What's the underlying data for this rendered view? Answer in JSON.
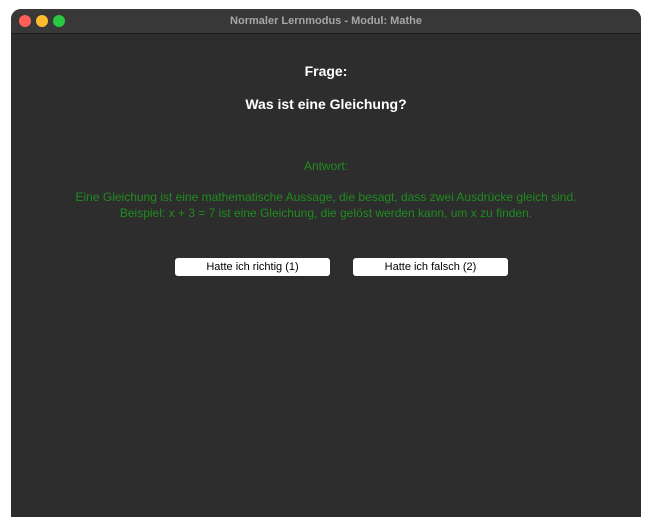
{
  "window": {
    "title": "Normaler Lernmodus - Modul: Mathe"
  },
  "question": {
    "label": "Frage:",
    "text": "Was ist eine Gleichung?"
  },
  "answer": {
    "label": "Antwort:",
    "line1": "Eine Gleichung ist eine mathematische Aussage, die besagt, dass zwei Ausdrücke gleich sind.",
    "line2": "Beispiel: x + 3 = 7 ist eine Gleichung, die gelöst werden kann, um x zu finden."
  },
  "buttons": {
    "correct_label": "Hatte ich richtig (1)",
    "wrong_label": "Hatte ich falsch (2)"
  },
  "colors": {
    "window_bg": "#2d2d2d",
    "answer_text": "#1e8c1e",
    "question_text": "#ffffff"
  }
}
